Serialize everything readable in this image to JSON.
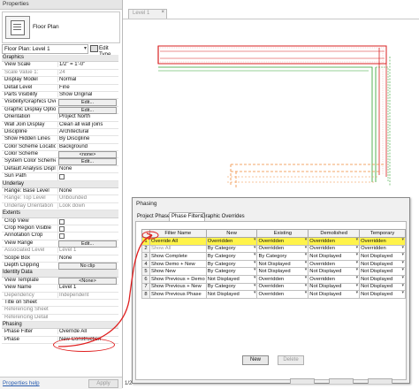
{
  "properties": {
    "title": "Properties",
    "type_name": "Floor Plan",
    "instance_label": "Floor Plan: Level 1",
    "edit_type_label": "Edit Type",
    "groups": [
      {
        "name": "Graphics",
        "rows": [
          {
            "k": "View Scale",
            "v": "1/2\" = 1'-0\"",
            "type": "text"
          },
          {
            "k": "Scale Value    1:",
            "v": "24",
            "type": "text",
            "dim": true
          },
          {
            "k": "Display Model",
            "v": "Normal",
            "type": "text"
          },
          {
            "k": "Detail Level",
            "v": "Fine",
            "type": "text"
          },
          {
            "k": "Parts Visibility",
            "v": "Show Original",
            "type": "text"
          },
          {
            "k": "Visibility/Graphics Over...",
            "v": "Edit...",
            "type": "button"
          },
          {
            "k": "Graphic Display Options",
            "v": "Edit...",
            "type": "button"
          },
          {
            "k": "Orientation",
            "v": "Project North",
            "type": "text"
          },
          {
            "k": "Wall Join Display",
            "v": "Clean all wall joins",
            "type": "text"
          },
          {
            "k": "Discipline",
            "v": "Architectural",
            "type": "text"
          },
          {
            "k": "Show Hidden Lines",
            "v": "By Discipline",
            "type": "text"
          },
          {
            "k": "Color Scheme Location",
            "v": "Background",
            "type": "text"
          },
          {
            "k": "Color Scheme",
            "v": "<none>",
            "type": "button"
          },
          {
            "k": "System Color Schemes",
            "v": "Edit...",
            "type": "button"
          },
          {
            "k": "Default Analysis Display...",
            "v": "None",
            "type": "text"
          },
          {
            "k": "Sun Path",
            "v": "",
            "type": "check"
          }
        ]
      },
      {
        "name": "Underlay",
        "rows": [
          {
            "k": "Range: Base Level",
            "v": "None",
            "type": "text"
          },
          {
            "k": "Range: Top Level",
            "v": "Unbounded",
            "type": "text",
            "dim": true
          },
          {
            "k": "Underlay Orientation",
            "v": "Look down",
            "type": "text",
            "dim": true
          }
        ]
      },
      {
        "name": "Extents",
        "rows": [
          {
            "k": "Crop View",
            "v": "",
            "type": "check"
          },
          {
            "k": "Crop Region Visible",
            "v": "",
            "type": "check"
          },
          {
            "k": "Annotation Crop",
            "v": "",
            "type": "check"
          },
          {
            "k": "View Range",
            "v": "Edit...",
            "type": "button"
          },
          {
            "k": "Associated Level",
            "v": "Level 1",
            "type": "text",
            "dim": true
          },
          {
            "k": "Scope Box",
            "v": "None",
            "type": "text"
          },
          {
            "k": "Depth Clipping",
            "v": "No clip",
            "type": "button"
          }
        ]
      },
      {
        "name": "Identity Data",
        "rows": [
          {
            "k": "View Template",
            "v": "<None>",
            "type": "button"
          },
          {
            "k": "View Name",
            "v": "Level 1",
            "type": "text"
          },
          {
            "k": "Dependency",
            "v": "Independent",
            "type": "text",
            "dim": true
          },
          {
            "k": "Title on Sheet",
            "v": "",
            "type": "text"
          },
          {
            "k": "Referencing Sheet",
            "v": "",
            "type": "text",
            "dim": true
          },
          {
            "k": "Referencing Detail",
            "v": "",
            "type": "text",
            "dim": true
          }
        ]
      },
      {
        "name": "Phasing",
        "rows": [
          {
            "k": "Phase Filter",
            "v": "Override All",
            "type": "text"
          },
          {
            "k": "Phase",
            "v": "New Construction",
            "type": "text"
          }
        ]
      }
    ],
    "help_link": "Properties help",
    "apply_label": "Apply"
  },
  "view": {
    "tab_label": "Level 1",
    "close_glyph": "×",
    "scale_text": "1/2"
  },
  "dialog": {
    "title": "Phasing",
    "tabs": [
      "Project Phases",
      "Phase Filters",
      "Graphic Overrides"
    ],
    "active_tab": 1,
    "columns": [
      "Filter Name",
      "New",
      "Existing",
      "Demolished",
      "Temporary"
    ],
    "rows": [
      {
        "n": "1",
        "name": "Override All",
        "new": "Overridden",
        "existing": "Overridden",
        "demolished": "Overridden",
        "temporary": "Overridden",
        "highlight": true
      },
      {
        "n": "2",
        "name": "Show All",
        "new": "By Category",
        "existing": "Overridden",
        "demolished": "Overridden",
        "temporary": "Overridden",
        "dim": true
      },
      {
        "n": "3",
        "name": "Show Complete",
        "new": "By Category",
        "existing": "By Category",
        "demolished": "Not Displayed",
        "temporary": "Not Displayed"
      },
      {
        "n": "4",
        "name": "Show Demo + New",
        "new": "By Category",
        "existing": "Not Displayed",
        "demolished": "Overridden",
        "temporary": "Not Displayed"
      },
      {
        "n": "5",
        "name": "Show New",
        "new": "By Category",
        "existing": "Not Displayed",
        "demolished": "Not Displayed",
        "temporary": "Not Displayed"
      },
      {
        "n": "6",
        "name": "Show Previous + Demo",
        "new": "Not Displayed",
        "existing": "Overridden",
        "demolished": "Overridden",
        "temporary": "Not Displayed"
      },
      {
        "n": "7",
        "name": "Show Previous + New",
        "new": "By Category",
        "existing": "Overridden",
        "demolished": "Not Displayed",
        "temporary": "Not Displayed"
      },
      {
        "n": "8",
        "name": "Show Previous Phase",
        "new": "Not Displayed",
        "existing": "Overridden",
        "demolished": "Not Displayed",
        "temporary": "Not Displayed"
      }
    ],
    "new_label": "New",
    "delete_label": "Delete"
  },
  "colors": {
    "annotation_red": "#e02020",
    "highlight_yellow": "#fff34a",
    "wall_red": "#d82020",
    "wall_green": "#2ca02c",
    "wall_orange": "#f08a3a"
  }
}
